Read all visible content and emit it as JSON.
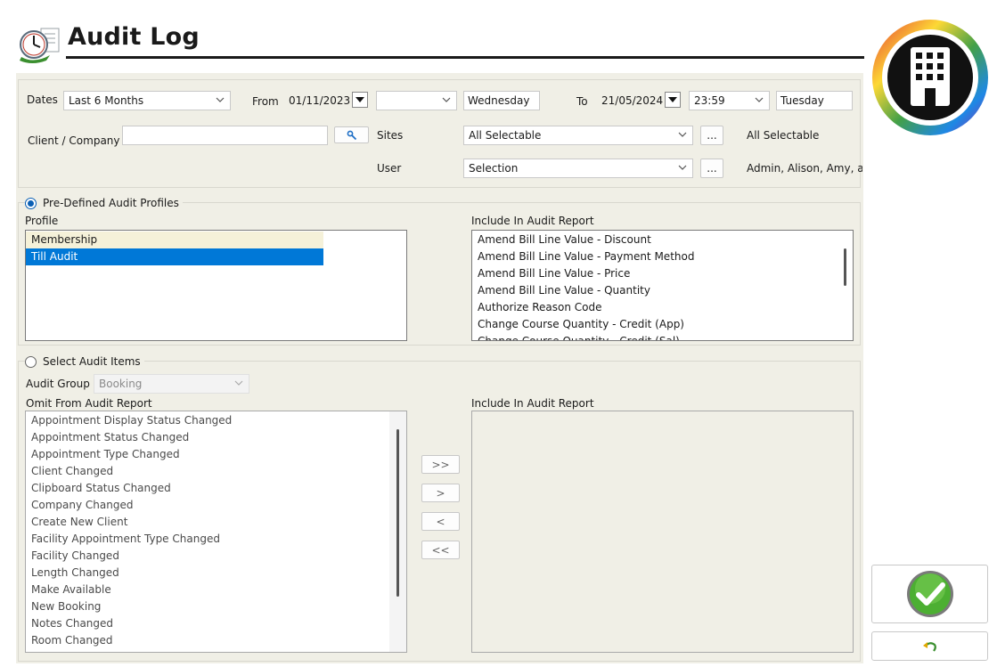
{
  "window": {
    "title": "Audit Log"
  },
  "filters": {
    "dates_label": "Dates",
    "dates_value": "Last 6 Months",
    "from_label": "From",
    "from_date": "01/11/2023",
    "from_time": "",
    "from_day": "Wednesday",
    "to_label": "To",
    "to_date": "21/05/2024",
    "to_time": "23:59",
    "to_day": "Tuesday",
    "client_label": "Client / Company",
    "client_value": "",
    "sites_label": "Sites",
    "sites_value": "All Selectable",
    "sites_summary": "All Selectable",
    "user_label": "User",
    "user_value": "Selection",
    "user_summary": "Admin, Alison, Amy, and",
    "ellipsis_label": "..."
  },
  "predefined": {
    "radio_label": "Pre-Defined Audit Profiles",
    "selected": true,
    "profile_label": "Profile",
    "profiles": [
      {
        "label": "Membership",
        "state": "highlight"
      },
      {
        "label": "Till Audit",
        "state": "selected"
      }
    ],
    "include_label": "Include In Audit Report",
    "include_items": [
      "Amend Bill Line Value - Discount",
      "Amend Bill Line Value - Payment Method",
      "Amend Bill Line Value - Price",
      "Amend Bill Line Value - Quantity",
      "Authorize Reason Code",
      "Change Course Quantity - Credit (App)",
      "Change Course Quantity - Credit (Sal)"
    ]
  },
  "select_items": {
    "radio_label": "Select Audit Items",
    "selected": false,
    "group_label": "Audit Group",
    "group_value": "Booking",
    "omit_label": "Omit From Audit Report",
    "omit_items": [
      "Appointment Display Status Changed",
      "Appointment Status Changed",
      "Appointment Type Changed",
      "Client Changed",
      "Clipboard Status Changed",
      "Company Changed",
      "Create New Client",
      "Facility Appointment Type Changed",
      "Facility Changed",
      "Length Changed",
      "Make Available",
      "New Booking",
      "Notes Changed",
      "Room Changed"
    ],
    "include_label": "Include In Audit Report",
    "include_items": [],
    "move_buttons": {
      "all_right": ">>",
      "right": ">",
      "left": "<",
      "all_left": "<<"
    }
  },
  "colors": {
    "accent": "#0a5fb4",
    "selection": "#0078d7",
    "highlight_row": "#f5f1d9",
    "panel": "#f0efe6",
    "ok_green": "#4caf32"
  }
}
